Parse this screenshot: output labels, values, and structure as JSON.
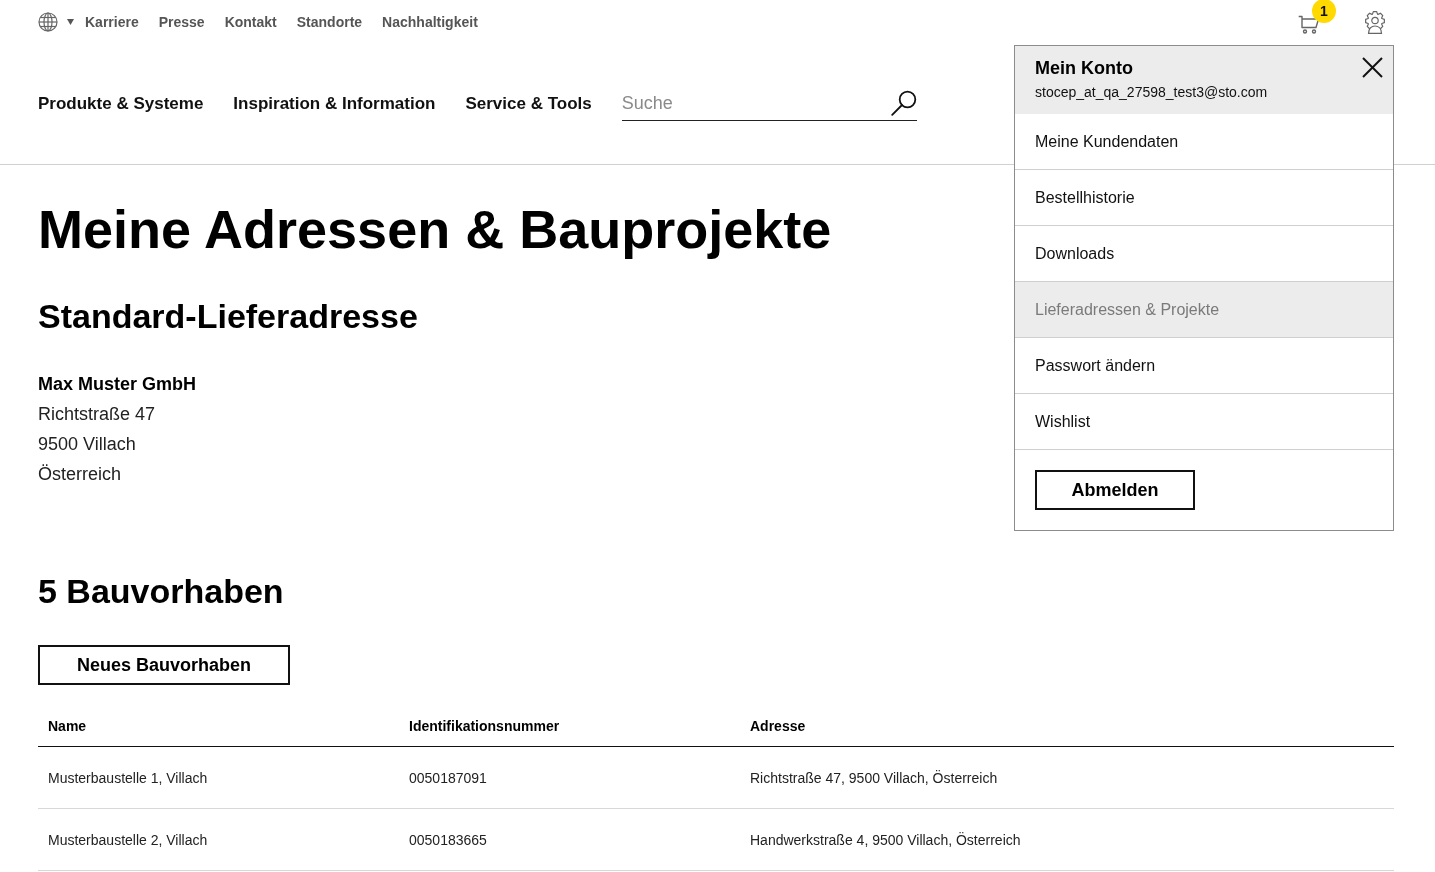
{
  "top_bar": {
    "links": [
      "Karriere",
      "Presse",
      "Kontakt",
      "Standorte",
      "Nachhaltigkeit"
    ],
    "cart_badge": "1"
  },
  "main_nav": {
    "items": [
      "Produkte & Systeme",
      "Inspiration & Information",
      "Service & Tools"
    ],
    "search": {
      "placeholder": "Suche"
    }
  },
  "page": {
    "title": "Meine Adressen & Bauprojekte",
    "default_address": {
      "heading": "Standard-Lieferadresse",
      "company": "Max Muster GmbH",
      "lines": [
        "Richtstraße 47",
        "9500 Villach",
        "Österreich"
      ]
    },
    "projects": {
      "heading": "5 Bauvorhaben",
      "new_button": "Neues Bauvorhaben",
      "table": {
        "columns": [
          "Name",
          "Identifikationsnummer",
          "Adresse"
        ],
        "rows": [
          [
            "Musterbaustelle 1, Villach",
            "0050187091",
            "Richtstraße 47, 9500 Villach, Österreich"
          ],
          [
            "Musterbaustelle 2, Villach",
            "0050183665",
            "Handwerkstraße 4, 9500 Villach, Österreich"
          ]
        ]
      }
    }
  },
  "account_menu": {
    "title": "Mein Konto",
    "email": "stocep_at_qa_27598_test3@sto.com",
    "items": [
      {
        "label": "Meine Kundendaten",
        "selected": false
      },
      {
        "label": "Bestellhistorie",
        "selected": false
      },
      {
        "label": "Downloads",
        "selected": false
      },
      {
        "label": "Lieferadressen & Projekte",
        "selected": true
      },
      {
        "label": "Passwort ändern",
        "selected": false
      },
      {
        "label": "Wishlist",
        "selected": false
      }
    ],
    "logout_button": "Abmelden"
  }
}
